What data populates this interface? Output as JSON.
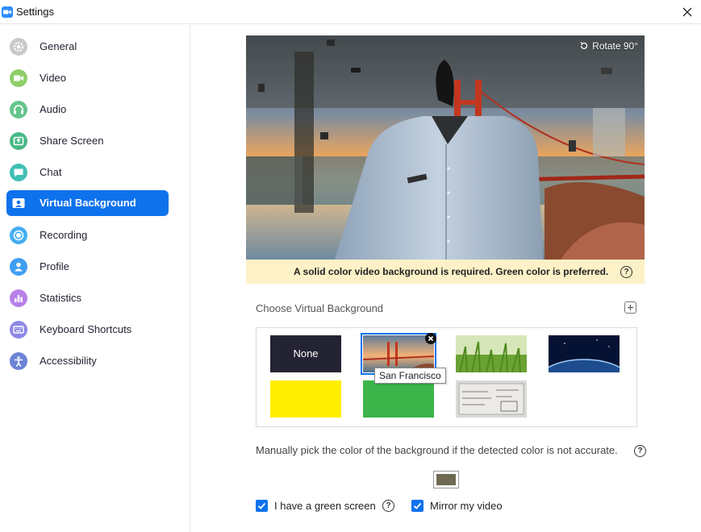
{
  "window": {
    "title": "Settings"
  },
  "sidebar": {
    "items": [
      {
        "label": "General",
        "icon": "gear-icon",
        "color": "#c9c9c9"
      },
      {
        "label": "Video",
        "icon": "video-camera-icon",
        "color": "#8fce69"
      },
      {
        "label": "Audio",
        "icon": "headphones-icon",
        "color": "#64c58a"
      },
      {
        "label": "Share Screen",
        "icon": "share-screen-icon",
        "color": "#48b986"
      },
      {
        "label": "Chat",
        "icon": "chat-bubble-icon",
        "color": "#3fbfb4"
      },
      {
        "label": "Virtual Background",
        "icon": "virtual-background-icon",
        "color": "#0e72ed"
      },
      {
        "label": "Recording",
        "icon": "recording-icon",
        "color": "#43aef2"
      },
      {
        "label": "Profile",
        "icon": "profile-icon",
        "color": "#3f9ef2"
      },
      {
        "label": "Statistics",
        "icon": "statistics-icon",
        "color": "#b780e8"
      },
      {
        "label": "Keyboard Shortcuts",
        "icon": "keyboard-icon",
        "color": "#8e88e6"
      },
      {
        "label": "Accessibility",
        "icon": "accessibility-icon",
        "color": "#6d83d6"
      }
    ],
    "active_index": 5
  },
  "preview": {
    "rotate_label": "Rotate 90°",
    "warning": "A solid color video background is required. Green color is preferred."
  },
  "backgrounds": {
    "section_label": "Choose Virtual Background",
    "none_label": "None",
    "selected_tooltip": "San Francisco",
    "items": [
      "None",
      "San Francisco",
      "grass",
      "earth",
      "yellow",
      "green",
      "whiteboard"
    ]
  },
  "color_pick": {
    "text": "Manually pick the color of the background if the detected color is not accurate.",
    "color": "#6e6a52"
  },
  "options": {
    "green_screen_label": "I have a green screen",
    "green_screen_checked": true,
    "mirror_label": "Mirror my video",
    "mirror_checked": true
  },
  "colors": {
    "accent": "#0e72ed",
    "warning_bg": "#fcf1c7",
    "yellow_bg": "#ffee00",
    "green_bg": "#3bb54a"
  }
}
